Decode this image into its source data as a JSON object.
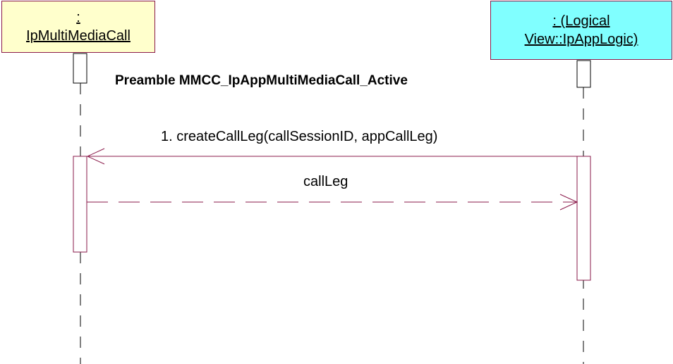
{
  "participants": {
    "left": {
      "line1": ":",
      "line2": "IpMultiMediaCall"
    },
    "right": {
      "line1": ": (Logical",
      "line2": "View::IpAppLogic)"
    }
  },
  "title": "Preamble MMCC_IpAppMultiMediaCall_Active",
  "messages": [
    {
      "label": "1. createCallLeg(callSessionID, appCallLeg)",
      "kind": "synchronous",
      "direction": "right-to-left"
    },
    {
      "label": "callLeg",
      "kind": "return",
      "direction": "left-to-right"
    }
  ],
  "colors": {
    "line": "#8a1a4a",
    "left_box_fill": "#ffffcc",
    "right_box_fill": "#80ffff",
    "lifeline": "#000000"
  }
}
